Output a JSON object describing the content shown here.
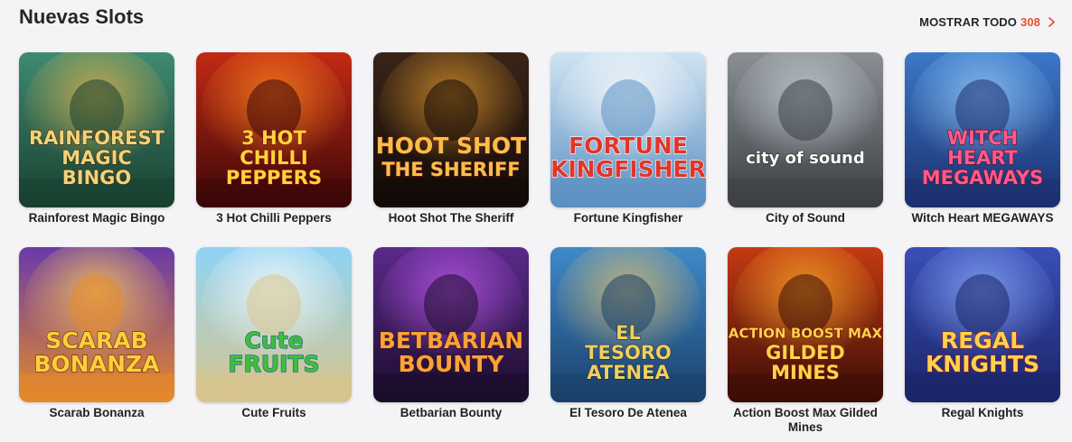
{
  "section": {
    "title": "Nuevas Slots",
    "show_all_label": "MOSTRAR TODO",
    "show_all_count": "308",
    "chevron_icon": "chevron-right-icon",
    "accent_color": "#e5513a"
  },
  "games": [
    {
      "name": "Rainforest Magic Bingo",
      "art": {
        "bg1": "#3f8a72",
        "bg2": "#18402f",
        "glow": "#e9b64a",
        "logo": [
          "RAINFOREST",
          "MAGIC",
          "BINGO"
        ],
        "logo_color": "#f2d27a",
        "stroke": "#3a2a10"
      }
    },
    {
      "name": "3 Hot Chilli Peppers",
      "art": {
        "bg1": "#c22a14",
        "bg2": "#3a0608",
        "glow": "#ff8a1e",
        "logo": [
          "3 HOT",
          "CHILLI",
          "PEPPERS"
        ],
        "logo_color": "#ffd43a",
        "stroke": "#7a0b06"
      }
    },
    {
      "name": "Hoot Shot The Sheriff",
      "art": {
        "bg1": "#3a2418",
        "bg2": "#120a08",
        "glow": "#e39a2b",
        "logo": [
          "HOOT SHOT",
          "THE SHERIFF"
        ],
        "logo_color": "#f5c04a",
        "stroke": "#7a1a10"
      }
    },
    {
      "name": "Fortune Kingfisher",
      "art": {
        "bg1": "#cfe3f2",
        "bg2": "#5a8fc2",
        "glow": "#ffffff",
        "logo": [
          "FORTUNE",
          "KINGFISHER"
        ],
        "logo_color": "#e2352a",
        "stroke": "#ffffff"
      }
    },
    {
      "name": "City of Sound",
      "art": {
        "bg1": "#8a8f94",
        "bg2": "#3b3f44",
        "glow": "#c9d3da",
        "logo": [
          "city of sound"
        ],
        "logo_color": "#ffffff",
        "stroke": "#2c2c2c"
      }
    },
    {
      "name": "Witch Heart MEGAWAYS",
      "art": {
        "bg1": "#3b78c8",
        "bg2": "#1b2f6e",
        "glow": "#9ad0ff",
        "logo": [
          "WITCH",
          "HEART",
          "MEGAWAYS"
        ],
        "logo_color": "#ff5a8a",
        "stroke": "#5a0f2a"
      }
    },
    {
      "name": "Scarab Bonanza",
      "art": {
        "bg1": "#6a3aa8",
        "bg2": "#e6892a",
        "glow": "#ffd35a",
        "logo": [
          "SCARAB",
          "BONANZA"
        ],
        "logo_color": "#ffcf3a",
        "stroke": "#6a2a06"
      }
    },
    {
      "name": "Cute Fruits",
      "art": {
        "bg1": "#8fd3f5",
        "bg2": "#d9c48a",
        "glow": "#ffffff",
        "logo": [
          "Cute",
          "FRUITS"
        ],
        "logo_color": "#3fbf3a",
        "stroke": "#1a5a8a"
      }
    },
    {
      "name": "Betbarian Bounty",
      "art": {
        "bg1": "#5a2a8a",
        "bg2": "#1a0c2a",
        "glow": "#c45af0",
        "logo": [
          "BETBARIAN",
          "BOUNTY"
        ],
        "logo_color": "#f7a23a",
        "stroke": "#4a1208"
      }
    },
    {
      "name": "El Tesoro De Atenea",
      "art": {
        "bg1": "#3f8ac9",
        "bg2": "#1a3f6a",
        "glow": "#e8c26a",
        "logo": [
          "EL",
          "TESORO",
          "ATENEA"
        ],
        "logo_color": "#f3cf5a",
        "stroke": "#0e2a52"
      }
    },
    {
      "name": "Action Boost Max Gilded Mines",
      "art": {
        "bg1": "#c43a12",
        "bg2": "#3a0c06",
        "glow": "#ffb02a",
        "logo": [
          "ACTION BOOST MAX",
          "GILDED",
          "MINES"
        ],
        "logo_color": "#ffd24a",
        "stroke": "#6a1206"
      }
    },
    {
      "name": "Regal Knights",
      "art": {
        "bg1": "#3a4fb8",
        "bg2": "#1a2466",
        "glow": "#8fb0ff",
        "logo": [
          "REGAL",
          "KNIGHTS"
        ],
        "logo_color": "#ffd24a",
        "stroke": "#a0162a"
      }
    }
  ]
}
